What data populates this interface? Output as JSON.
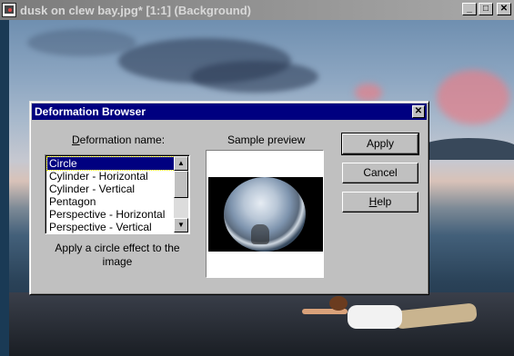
{
  "image_window": {
    "title": "dusk on clew bay.jpg* [1:1] (Background)",
    "controls": {
      "minimize": "_",
      "maximize": "□",
      "close": "✕"
    }
  },
  "dialog": {
    "title": "Deformation Browser",
    "close": "✕",
    "deformation_label_prefix": "",
    "deformation_label_mnemonic": "D",
    "deformation_label_rest": "eformation name:",
    "list_items": [
      "Circle",
      "Cylinder - Horizontal",
      "Cylinder - Vertical",
      "Pentagon",
      "Perspective - Horizontal",
      "Perspective - Vertical"
    ],
    "selected_index": 0,
    "scroll_up": "▲",
    "scroll_down": "▼",
    "description_line1": "Apply a circle effect to the",
    "description_line2": "image",
    "preview_label": "Sample preview",
    "buttons": {
      "apply": "Apply",
      "cancel": "Cancel",
      "help_mnemonic": "H",
      "help_rest": "elp"
    }
  }
}
